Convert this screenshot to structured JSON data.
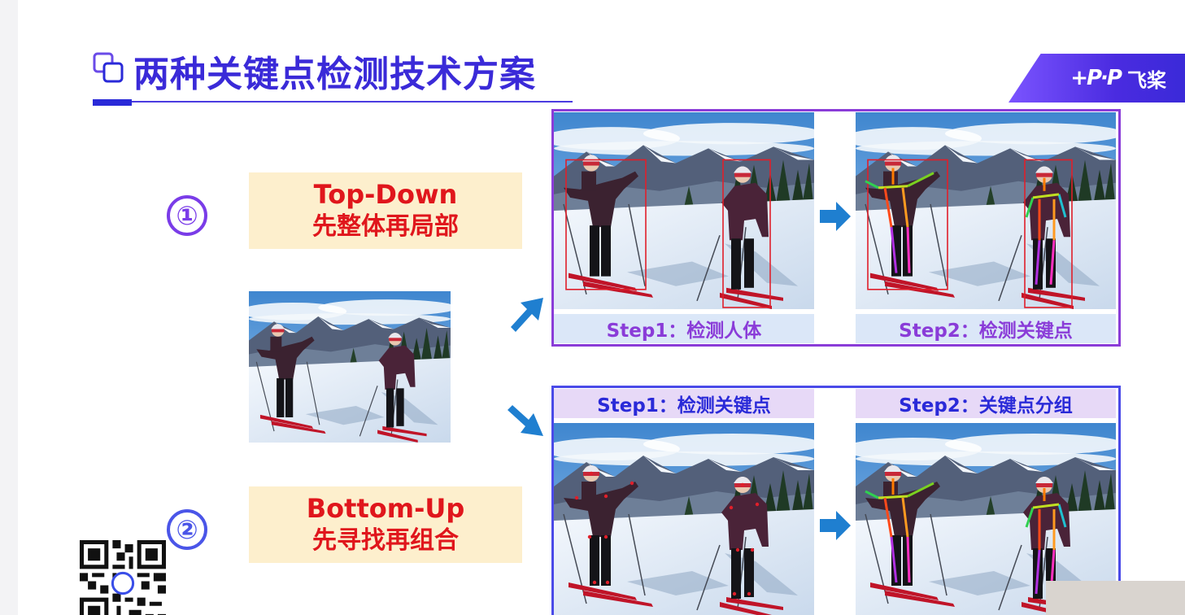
{
  "title": "两种关键点检测技术方案",
  "logo": {
    "mark": "+P·P",
    "text": "飞桨"
  },
  "methods": [
    {
      "number": "①",
      "name_en": "Top-Down",
      "name_cn": "先整体再局部"
    },
    {
      "number": "②",
      "name_en": "Bottom-Up",
      "name_cn": "先寻找再组合"
    }
  ],
  "top_steps": [
    "Step1：检测人体",
    "Step2：检测关键点"
  ],
  "bottom_steps": [
    "Step1：检测关键点",
    "Step2：关键点分组"
  ],
  "colors": {
    "title": "#3a2ad8",
    "method_label": "#e0161c",
    "label_background": "#fdefcd",
    "top_frame": "#8a3cd8",
    "bottom_frame": "#4a4ae8",
    "arrow": "#1f7fd0"
  }
}
